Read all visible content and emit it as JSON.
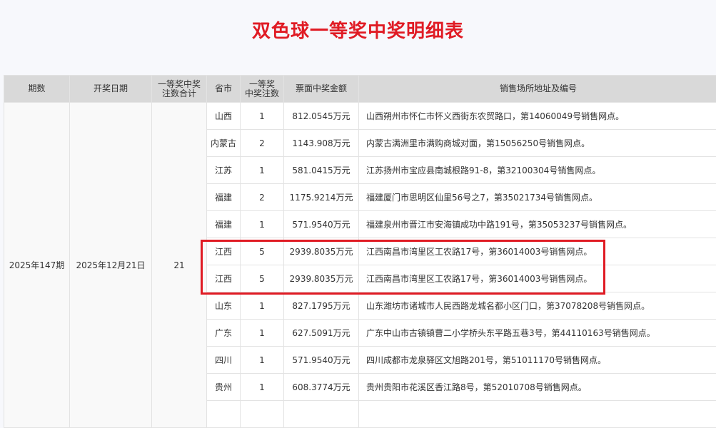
{
  "page": {
    "title": "双色球一等奖中奖明细表"
  },
  "table": {
    "headers": {
      "period": "期数",
      "draw_date": "开奖日期",
      "total_line1": "一等奖中奖",
      "total_line2": "注数合计",
      "province": "省市",
      "count_line1": "一等奖",
      "count_line2": "中奖注数",
      "amount": "票面中奖金额",
      "address": "销售场所地址及编号"
    },
    "period": "2025年147期",
    "draw_date": "2025年12月21日",
    "total_winners": "21",
    "rows": [
      {
        "province": "山西",
        "count": "1",
        "amount": "812.0545万元",
        "address": "山西朔州市怀仁市怀义西街东农贸路口，第14060049号销售网点。"
      },
      {
        "province": "内蒙古",
        "count": "2",
        "amount": "1143.908万元",
        "address": "内蒙古满洲里市满购商城对面，第15056250号销售网点。"
      },
      {
        "province": "江苏",
        "count": "1",
        "amount": "581.0415万元",
        "address": "江苏扬州市宝应县南城根路91-8，第32100304号销售网点。"
      },
      {
        "province": "福建",
        "count": "2",
        "amount": "1175.9214万元",
        "address": "福建厦门市思明区仙里56号之7，第35021734号销售网点。"
      },
      {
        "province": "福建",
        "count": "1",
        "amount": "571.9540万元",
        "address": "福建泉州市晋江市安海镇成功中路191号，第35053237号销售网点。"
      },
      {
        "province": "江西",
        "count": "5",
        "amount": "2939.8035万元",
        "address": "江西南昌市湾里区工农路17号，第36014003号销售网点。"
      },
      {
        "province": "江西",
        "count": "5",
        "amount": "2939.8035万元",
        "address": "江西南昌市湾里区工农路17号，第36014003号销售网点。"
      },
      {
        "province": "山东",
        "count": "1",
        "amount": "827.1795万元",
        "address": "山东潍坊市诸城市人民西路龙城名都小区门口，第37078208号销售网点。"
      },
      {
        "province": "广东",
        "count": "1",
        "amount": "627.5091万元",
        "address": "广东中山市古镇镇曹二小学桥头东平路五巷3号，第44110163号销售网点。"
      },
      {
        "province": "四川",
        "count": "1",
        "amount": "571.9540万元",
        "address": "四川成都市龙泉驿区文旭路201号，第51011170号销售网点。"
      },
      {
        "province": "贵州",
        "count": "1",
        "amount": "608.3774万元",
        "address": "贵州贵阳市花溪区香江路8号，第52010708号销售网点。"
      }
    ]
  },
  "highlight": {
    "color": "#e01b24",
    "rows": [
      6,
      7
    ]
  }
}
